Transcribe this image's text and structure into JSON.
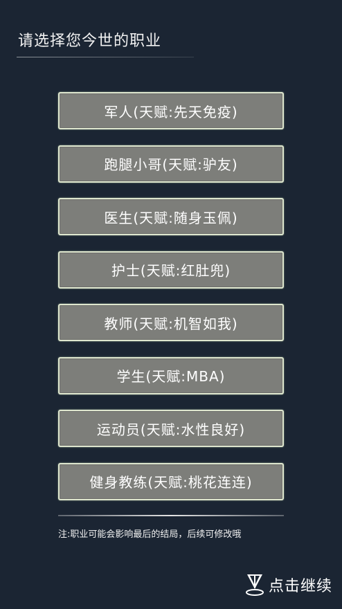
{
  "header": {
    "title": "请选择您今世的职业"
  },
  "options": [
    {
      "label": "军人(天赋:先天免疫)"
    },
    {
      "label": "跑腿小哥(天赋:驴友)"
    },
    {
      "label": "医生(天赋:随身玉佩)"
    },
    {
      "label": "护士(天赋:红肚兜)"
    },
    {
      "label": "教师(天赋:机智如我)"
    },
    {
      "label": "学生(天赋:MBA)"
    },
    {
      "label": "运动员(天赋:水性良好)"
    },
    {
      "label": "健身教练(天赋:桃花连连)"
    }
  ],
  "footer": {
    "note": "注:职业可能会影响最后的结局，后续可修改哦",
    "continue_label": "点击继续",
    "continue_icon": "pointer-arrow-icon"
  },
  "colors": {
    "background": "#1b2533",
    "button_fill": "#7d7e7a",
    "button_border": "#dfe7cf",
    "text": "#ffffff"
  }
}
